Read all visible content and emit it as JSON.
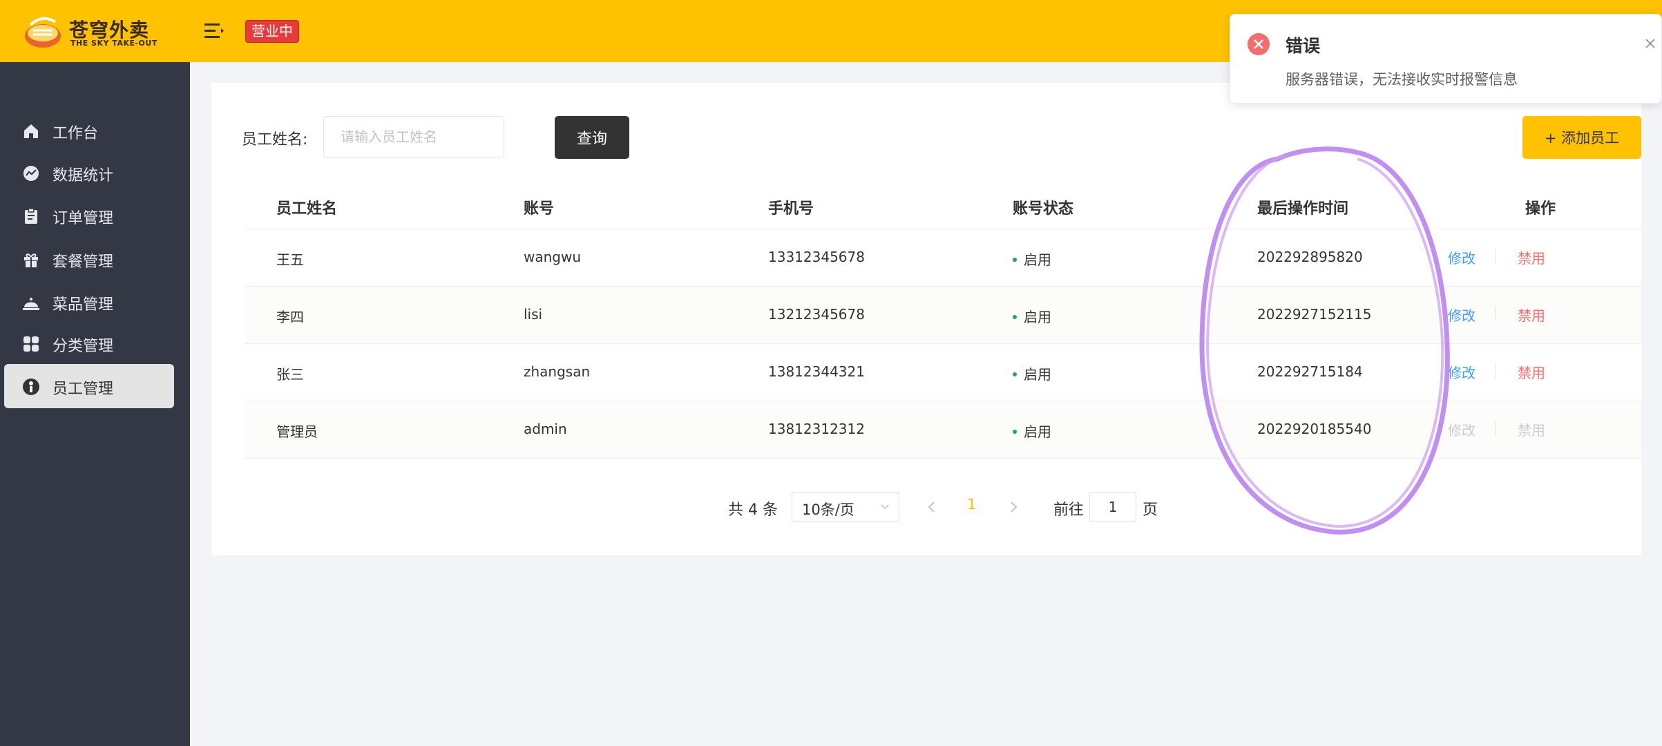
{
  "header": {
    "logo_cn": "苍穹外卖",
    "logo_en": "THE SKY TAKE-OUT",
    "status_tag": "营业中",
    "brand_color": "#ffc200"
  },
  "sidebar": {
    "items": [
      {
        "label": "工作台",
        "icon": "home-icon"
      },
      {
        "label": "数据统计",
        "icon": "chart-icon"
      },
      {
        "label": "订单管理",
        "icon": "clipboard-icon"
      },
      {
        "label": "套餐管理",
        "icon": "gift-icon"
      },
      {
        "label": "菜品管理",
        "icon": "cloche-icon"
      },
      {
        "label": "分类管理",
        "icon": "grid-icon"
      },
      {
        "label": "员工管理",
        "icon": "employee-icon",
        "active": true
      }
    ]
  },
  "search": {
    "label": "员工姓名:",
    "placeholder": "请输入员工姓名",
    "value": "",
    "query_button": "查询"
  },
  "add_button": "+ 添加员工",
  "table": {
    "headers": [
      "员工姓名",
      "账号",
      "手机号",
      "账号状态",
      "最后操作时间",
      "操作"
    ],
    "rows": [
      {
        "name": "王五",
        "account": "wangwu",
        "phone": "13312345678",
        "status": "启用",
        "last_op": "202292895820",
        "edit": "修改",
        "disable": "禁用"
      },
      {
        "name": "李四",
        "account": "lisi",
        "phone": "13212345678",
        "status": "启用",
        "last_op": "2022927152115",
        "edit": "修改",
        "disable": "禁用"
      },
      {
        "name": "张三",
        "account": "zhangsan",
        "phone": "13812344321",
        "status": "启用",
        "last_op": "202292715184",
        "edit": "修改",
        "disable": "禁用"
      },
      {
        "name": "管理员",
        "account": "admin",
        "phone": "13812312312",
        "status": "启用",
        "last_op": "2022920185540",
        "edit": "修改",
        "disable": "禁用"
      }
    ]
  },
  "pagination": {
    "total": "共 4 条",
    "page_size": "10条/页",
    "current_page": "1",
    "goto_label": "前往",
    "goto_value": "1",
    "goto_unit": "页"
  },
  "notification": {
    "title": "错误",
    "message": "服务器错误，无法接收实时报警信息",
    "type": "error",
    "color": "#f56c6c"
  }
}
